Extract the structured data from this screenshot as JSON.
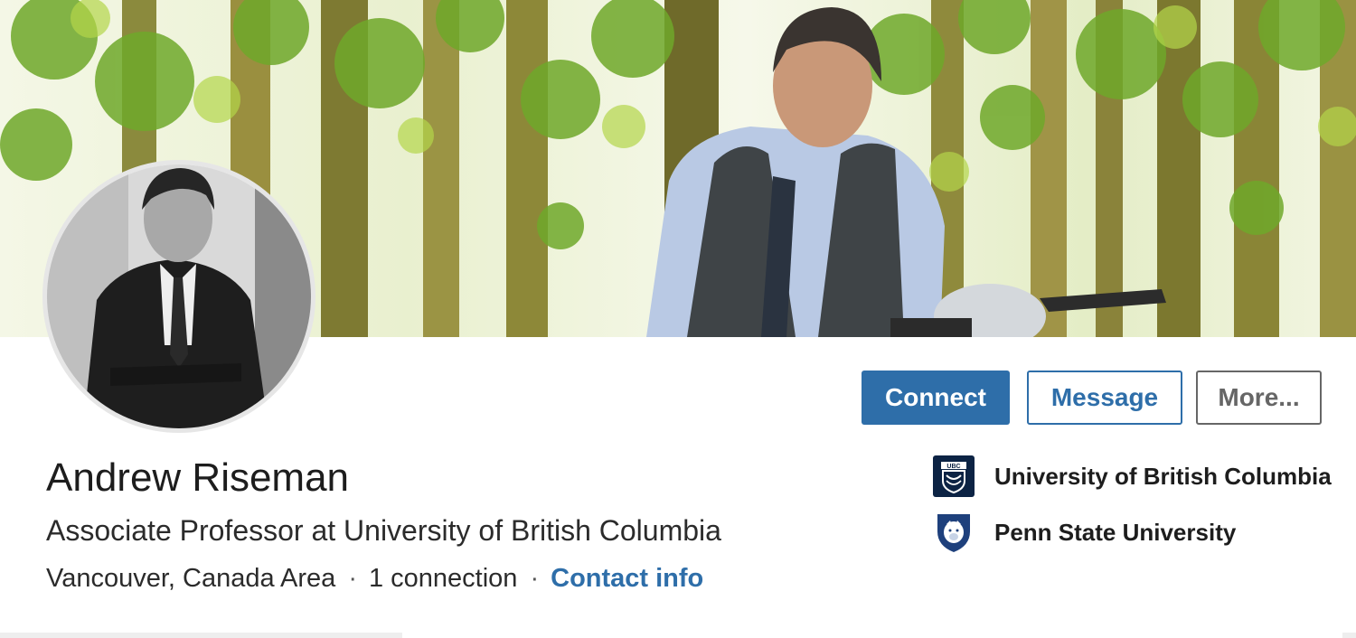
{
  "profile": {
    "name": "Andrew Riseman",
    "headline": "Associate Professor at University of British Columbia",
    "location": "Vancouver, Canada Area",
    "separator": "·",
    "connections": "1 connection",
    "contact_info_label": "Contact info"
  },
  "actions": {
    "connect_label": "Connect",
    "message_label": "Message",
    "more_label": "More..."
  },
  "education": [
    {
      "name": "University of British Columbia",
      "logo": "ubc-logo",
      "logo_text": "UBC"
    },
    {
      "name": "Penn State University",
      "logo": "penn-state-logo"
    }
  ],
  "colors": {
    "accent": "#2e6ea9",
    "secondary_button": "#666666",
    "text": "#1d1d1d",
    "ubc_navy": "#0c2344",
    "penn_navy": "#1e407c"
  }
}
